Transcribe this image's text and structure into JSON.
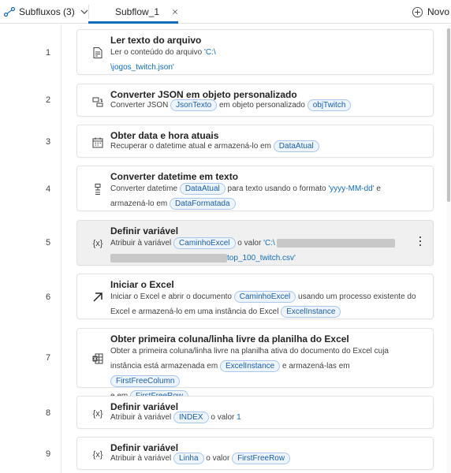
{
  "header": {
    "subflows_label": "Subfluxos (3)",
    "tab_label": "Subflow_1",
    "new_label": "Novo"
  },
  "steps": [
    {
      "number": "1",
      "title": "Ler texto do arquivo",
      "prefix": "Ler o conteúdo do arquivo ",
      "path_start": "'C:\\",
      "path_end": "\\jogos_twitch.json'"
    },
    {
      "number": "2",
      "title": "Converter JSON em objeto personalizado",
      "prefix": "Converter JSON ",
      "var1": "JsonTexto",
      "middle": " em objeto personalizado ",
      "var2": "objTwitch"
    },
    {
      "number": "3",
      "title": "Obter data e hora atuais",
      "prefix": "Recuperar o datetime atual e armazená-lo em ",
      "var1": "DataAtual"
    },
    {
      "number": "4",
      "title": "Converter datetime em texto",
      "prefix": "Converter datetime ",
      "var1": "DataAtual",
      "middle": " para texto usando o formato ",
      "format": "'yyyy-MM-dd'",
      "after": " e",
      "line2_prefix": "armazená-lo em ",
      "var2": "DataFormatada"
    },
    {
      "number": "5",
      "title": "Definir variável",
      "prefix": "Atribuir à variável ",
      "var1": "CaminhoExcel",
      "middle": " o valor ",
      "path_start": "'C:\\",
      "path_end": "top_100_twitch.csv'"
    },
    {
      "number": "6",
      "title": "Iniciar o Excel",
      "prefix": "Iniciar o Excel e abrir o documento ",
      "var1": "CaminhoExcel",
      "middle": " usando um processo existente do",
      "line2_prefix": "Excel e armazená-lo em uma instância do Excel ",
      "var2": "ExcelInstance"
    },
    {
      "number": "7",
      "title": "Obter primeira coluna/linha livre da planilha do Excel",
      "line1": "Obter a primeira coluna/linha livre na planilha ativa do documento do Excel cuja",
      "line2_prefix": "instância está armazenada em ",
      "var1": "ExcelInstance",
      "middle": " e armazená-las em ",
      "var2": "FirstFreeColumn",
      "line3_prefix": "e em ",
      "var3": "FirstFreeRow"
    },
    {
      "number": "8",
      "title": "Definir variável",
      "prefix": "Atribuir à variável ",
      "var1": "INDEX",
      "middle": " o valor ",
      "value": "1"
    },
    {
      "number": "9",
      "title": "Definir variável",
      "prefix": "Atribuir à variável ",
      "var1": "Linha",
      "middle": " o valor ",
      "var2": "FirstFreeRow"
    }
  ],
  "icons": {
    "subflows": "subflow-icon",
    "chevron": "chevron-down-icon",
    "close": "close-icon",
    "new": "plus-circle-icon",
    "read_file": "file-read-icon",
    "convert_json": "convert-icon",
    "calendar": "calendar-icon",
    "datetime_text": "datetime-text-icon",
    "variable": "variable-icon",
    "launch_excel": "launch-arrow-icon",
    "excel": "excel-icon",
    "more": "more-vertical-icon"
  },
  "colors": {
    "accent": "#0f6cbd",
    "pill_border": "#a8c7ea",
    "pill_bg": "#eef4fb",
    "selected_card": "#f0f0f0"
  }
}
